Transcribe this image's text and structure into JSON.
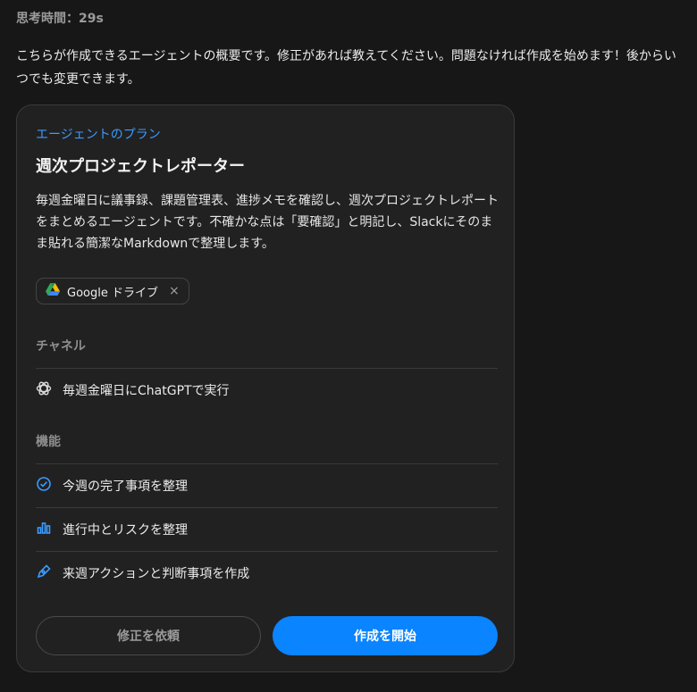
{
  "thinking": {
    "label": "思考時間：29s"
  },
  "message": {
    "text": "こちらが作成できるエージェントの概要です。修正があれば教えてください。問題なければ作成を始めます！後からいつでも変更できます。"
  },
  "card": {
    "kicker": "エージェントのプラン",
    "title": "週次プロジェクトレポーター",
    "description": "毎週金曜日に議事録、課題管理表、進捗メモを確認し、週次プロジェクトレポートをまとめるエージェントです。不確かな点は「要確認」と明記し、Slackにそのまま貼れる簡潔なMarkdownで整理します。",
    "chip": {
      "label": "Google ドライブ",
      "icon": "google-drive-icon",
      "close": "×"
    },
    "channel": {
      "label": "チャネル",
      "item": {
        "label": "毎週金曜日にChatGPTで実行",
        "icon": "chatgpt-icon"
      }
    },
    "features": {
      "label": "機能",
      "items": [
        {
          "label": "今週の完了事項を整理",
          "icon": "check-circle-icon"
        },
        {
          "label": "進行中とリスクを整理",
          "icon": "bar-chart-icon"
        },
        {
          "label": "来週アクションと判断事項を作成",
          "icon": "pen-icon"
        }
      ]
    },
    "buttons": {
      "revise": "修正を依頼",
      "start": "作成を開始"
    }
  },
  "colors": {
    "background": "#171717",
    "card": "#212121",
    "accent": "#0a84ff",
    "kicker": "#3b9bff"
  }
}
